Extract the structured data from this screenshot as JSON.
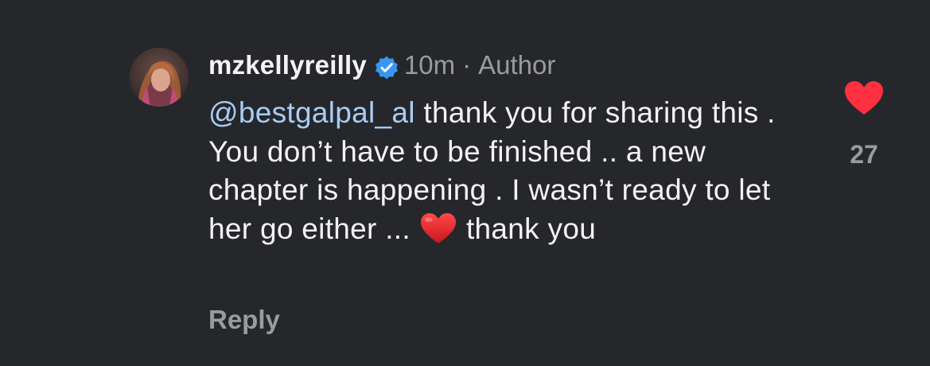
{
  "comment": {
    "username": "mzkellyreilly",
    "verified_icon": "verified-badge-icon",
    "timestamp": "10m",
    "separator": "·",
    "role": "Author",
    "mention": "@bestgalpal_al",
    "text_before_emoji": " thank you for sharing this . You don’t have to be finished .. a new chapter is happening . I wasn’t ready to let her go either ...",
    "emoji": "red-heart-emoji",
    "text_after_emoji": "thank you",
    "reply_label": "Reply",
    "like_icon": "heart-icon",
    "like_count": "27"
  },
  "colors": {
    "background": "#26272b",
    "text": "#f3f3f5",
    "secondary_text": "#9a9ba0",
    "mention": "#a9cdf5",
    "verified_badge": "#3897f0",
    "like": "#ff3040"
  }
}
